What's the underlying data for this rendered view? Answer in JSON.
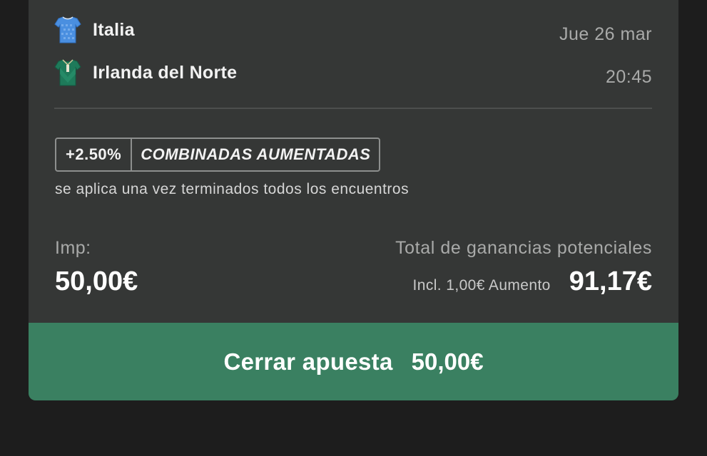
{
  "match": {
    "home_team": {
      "name": "Italia",
      "jersey_icon": "italy-jersey-icon",
      "jersey_color": "#4a8fe0"
    },
    "away_team": {
      "name": "Irlanda del Norte",
      "jersey_icon": "northern-ireland-jersey-icon",
      "jersey_color": "#1e7a5a"
    },
    "date": "Jue 26 mar",
    "time": "20:45"
  },
  "boost": {
    "percent": "+2.50%",
    "label": "COMBINADAS AUMENTADAS",
    "note": "se aplica una vez terminados todos los encuentros"
  },
  "bet": {
    "stake_label": "Imp:",
    "stake_value": "50,00€",
    "returns_label": "Total de ganancias potenciales",
    "boost_included": "Incl. 1,00€ Aumento",
    "returns_value": "91,17€"
  },
  "cashout": {
    "label": "Cerrar apuesta",
    "amount": "50,00€",
    "color": "#3a8061"
  },
  "colors": {
    "background": "#1d1d1d",
    "card": "#353736"
  }
}
